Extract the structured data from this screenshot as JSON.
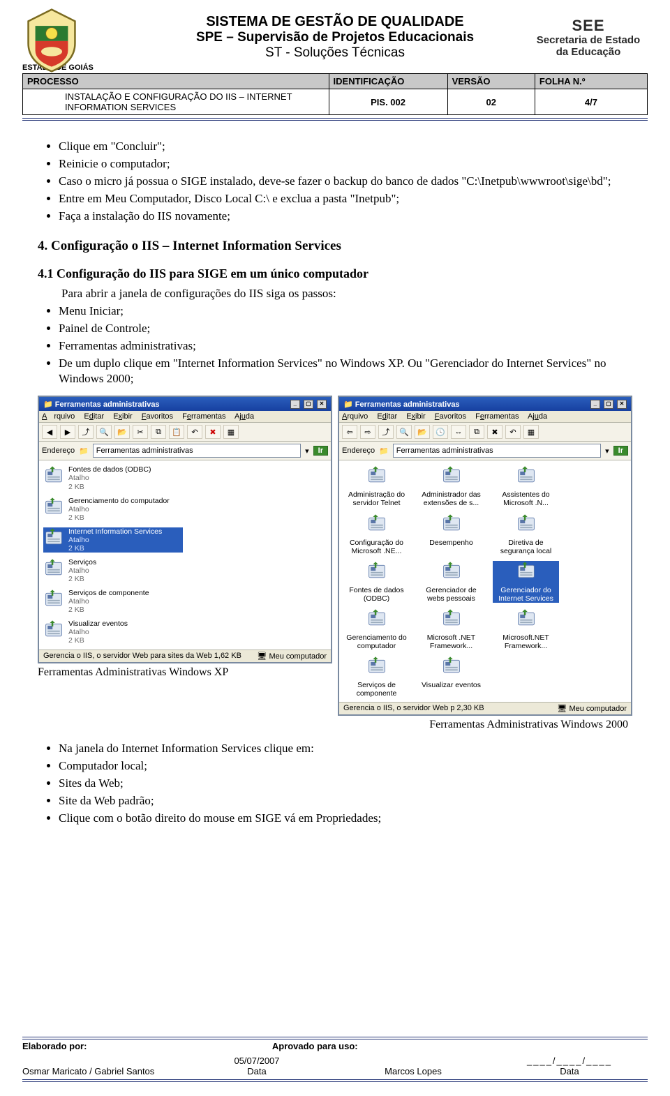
{
  "header": {
    "estado": "ESTADO DE GOIÁS",
    "title1": "SISTEMA DE GESTÃO DE QUALIDADE",
    "title2": "SPE – Supervisão de Projetos Educacionais",
    "title3": "ST - Soluções Técnicas",
    "right_see": "SEE",
    "right_line1": "Secretaria de Estado",
    "right_line2": "da Educação"
  },
  "meta": {
    "processo_label": "PROCESSO",
    "ident_label": "IDENTIFICAÇÃO",
    "versao_label": "VERSÃO",
    "folha_label": "FOLHA N.º",
    "processo_value": "INSTALAÇÃO E CONFIGURAÇÃO DO IIS – INTERNET INFORMATION SERVICES",
    "ident_value": "PIS. 002",
    "versao_value": "02",
    "folha_value": "4/7"
  },
  "bullets_top": [
    "Clique em \"Concluir\";",
    "Reinicie o computador;",
    "Caso o micro já possua o SIGE instalado, deve-se fazer o backup do banco de dados \"C:\\Inetpub\\wwwroot\\sige\\bd\";",
    "Entre em Meu Computador, Disco Local C:\\ e exclua a pasta \"Inetpub\";",
    "Faça a instalação do IIS novamente;"
  ],
  "section4_title": "4. Configuração o IIS – Internet Information Services",
  "section41_title": "4.1 Configuração do IIS para SIGE em um único computador",
  "para_intro": "Para abrir a janela de configurações do IIS siga os passos:",
  "bullets_steps": [
    "Menu Iniciar;",
    "Painel de Controle;",
    "Ferramentas administrativas;",
    "De um duplo clique em \"Internet Information Services\" no Windows XP. Ou \"Gerenciador do Internet Services\" no Windows 2000;"
  ],
  "win_title": "Ferramentas administrativas",
  "menu": {
    "arquivo": "Arquivo",
    "editar": "Editar",
    "exibir": "Exibir",
    "favoritos": "Favoritos",
    "ferramentas": "Ferramentas",
    "ajuda": "Ajuda"
  },
  "addr_label": "Endereço",
  "addr_value_xp": "Ferramentas administrativas",
  "addr_value_2k": "Ferramentas administrativas",
  "go_label": "Ir",
  "xp_tiles": [
    {
      "name": "Fontes de dados (ODBC)",
      "sub": "Atalho\n2 KB"
    },
    {
      "name": "Gerenciamento do computador",
      "sub": "Atalho\n2 KB"
    },
    {
      "name": "Internet Information Services",
      "sub": "Atalho\n2 KB",
      "sel": true
    },
    {
      "name": "Serviços",
      "sub": "Atalho\n2 KB"
    },
    {
      "name": "Serviços de componente",
      "sub": "Atalho\n2 KB"
    },
    {
      "name": "Visualizar eventos",
      "sub": "Atalho\n2 KB"
    }
  ],
  "xp_status_left": "Gerencia o IIS, o servidor Web para sites da Web 1,62 KB",
  "xp_status_right": "Meu computador",
  "w2k_tiles": [
    {
      "name": "Administração do servidor Telnet"
    },
    {
      "name": "Administrador das extensões de s..."
    },
    {
      "name": "Assistentes do Microsoft .N..."
    },
    {
      "name": "Configuração do Microsoft .NE..."
    },
    {
      "name": "Desempenho"
    },
    {
      "name": "Diretiva de segurança local"
    },
    {
      "name": "Fontes de dados (ODBC)"
    },
    {
      "name": "Gerenciador de webs pessoais"
    },
    {
      "name": "Gerenciador do Internet Services",
      "sel": true
    },
    {
      "name": "Gerenciamento do computador"
    },
    {
      "name": "Microsoft .NET Framework..."
    },
    {
      "name": "Microsoft.NET Framework..."
    },
    {
      "name": "Serviços de componente"
    },
    {
      "name": "Visualizar eventos"
    }
  ],
  "w2k_status_left": "Gerencia o IIS, o servidor Web p 2,30 KB",
  "w2k_status_right": "Meu computador",
  "caption_xp": "Ferramentas Administrativas Windows XP",
  "caption_2k": "Ferramentas Administrativas Windows 2000",
  "bullets_bottom_intro": [
    "Na janela do Internet Information Services clique em:",
    "Computador local;",
    "Sites da Web;",
    "Site da Web padrão;",
    "Clique com o botão direito do mouse em SIGE vá em Propriedades;"
  ],
  "footer": {
    "elab_label": "Elaborado por:",
    "aprov_label": "Aprovado para uso:",
    "date": "05/07/2007",
    "authors": "Osmar Maricato / Gabriel Santos",
    "data_lbl": "Data",
    "aprov_name": "Marcos Lopes",
    "aprov_date": "____/____/____"
  }
}
